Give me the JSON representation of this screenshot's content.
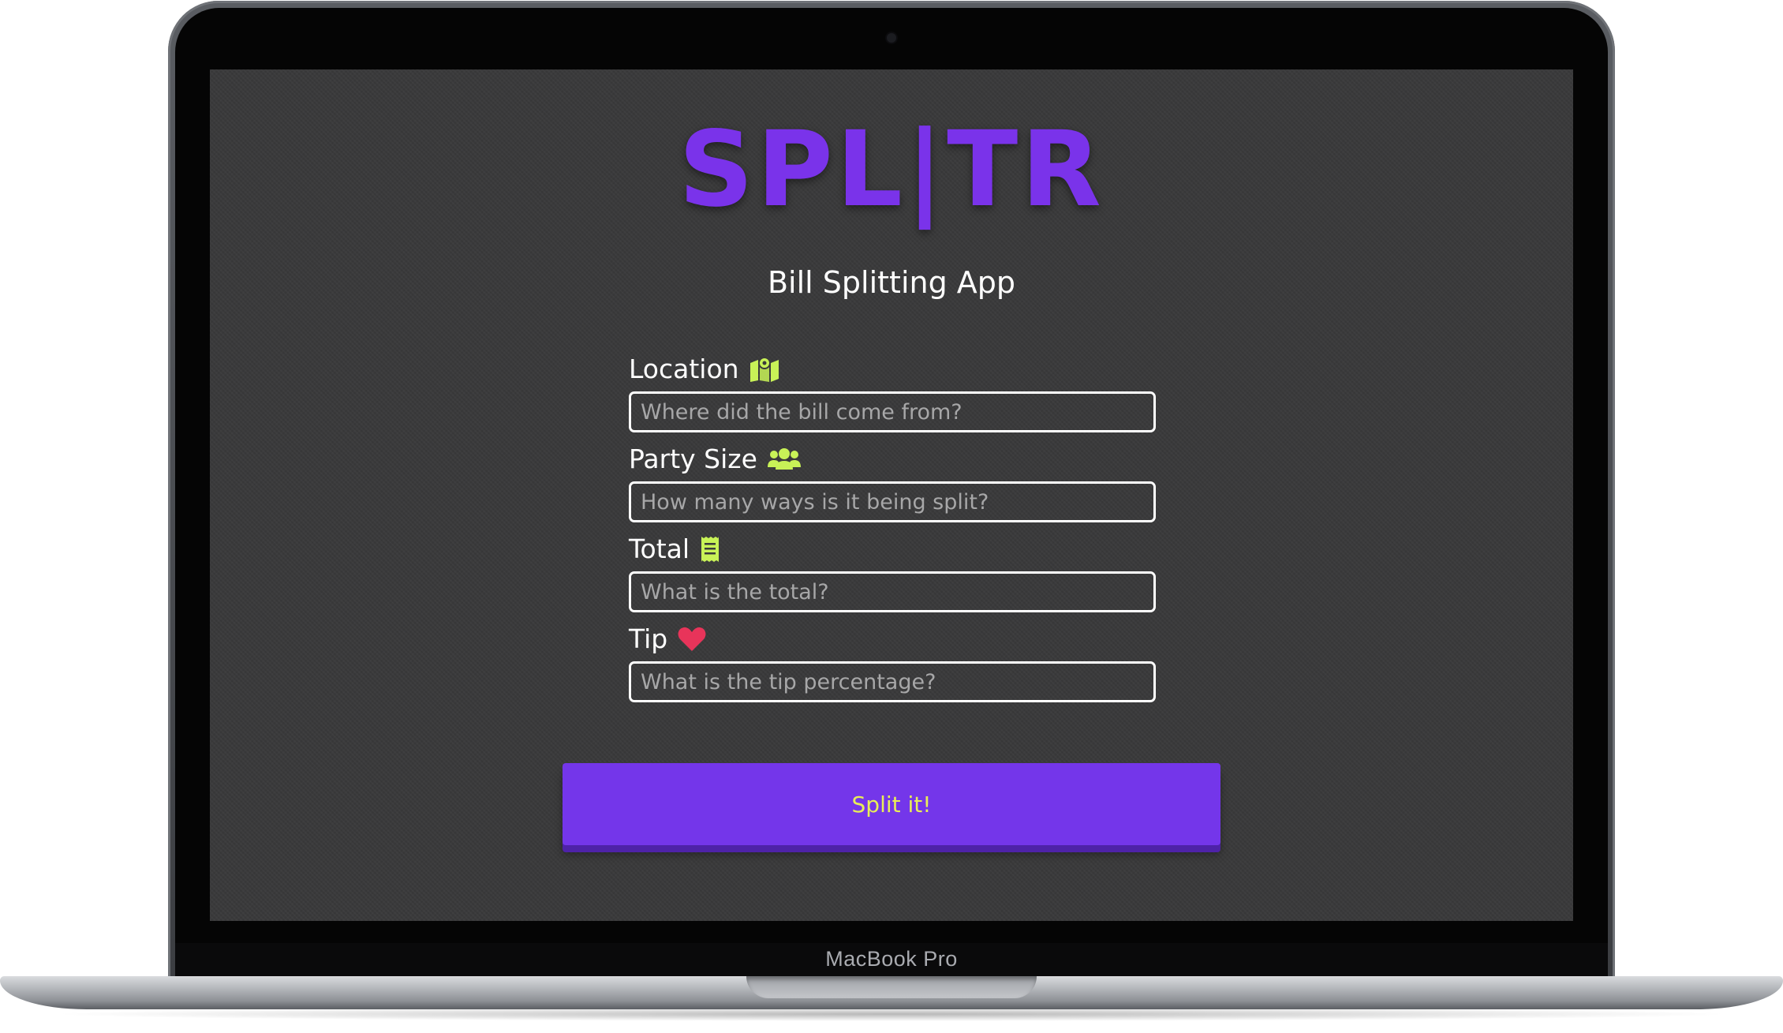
{
  "device": {
    "brand_label": "MacBook Pro"
  },
  "app": {
    "logo_text": "SPL|TR",
    "subtitle": "Bill Splitting App",
    "accent_color": "#7436ea",
    "icon_color": "#c8f257",
    "heart_color": "#e8345a",
    "button_text_color": "#e8ee58"
  },
  "form": {
    "location": {
      "label": "Location",
      "icon": "map-icon",
      "placeholder": "Where did the bill come from?"
    },
    "party_size": {
      "label": "Party Size",
      "icon": "users-icon",
      "placeholder": "How many ways is it being split?"
    },
    "total": {
      "label": "Total",
      "icon": "receipt-icon",
      "placeholder": "What is the total?"
    },
    "tip": {
      "label": "Tip",
      "icon": "heart-icon",
      "placeholder": "What is the tip percentage?"
    },
    "submit_label": "Split it!"
  }
}
